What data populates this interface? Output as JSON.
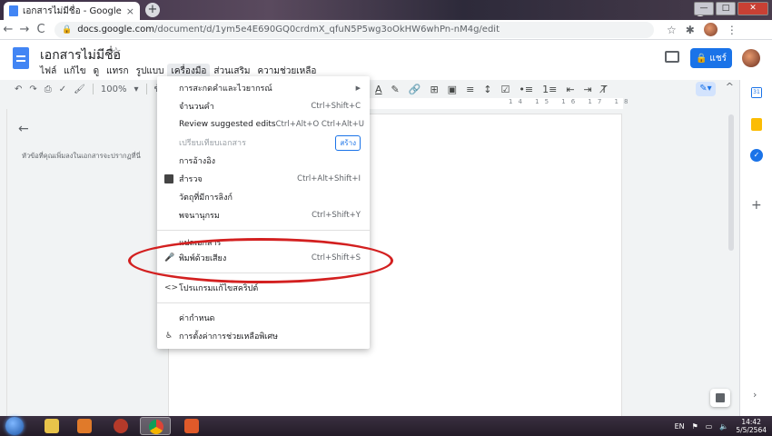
{
  "browser": {
    "tab_title": "เอกสารไม่มีชื่อ - Google เอกสาร",
    "tab_close": "×",
    "new_tab": "+",
    "url_host": "docs.google.com",
    "url_path": "/document/d/1ym5e4E690GQ0crdmX_qfuN5P5wg3oOkHW6whPn-nM4g/edit",
    "back": "←",
    "forward": "→",
    "reload": "C",
    "window_minimize": "—",
    "window_maximize": "□",
    "window_close": "✕"
  },
  "docs": {
    "title": "เอกสารไม่มีชื่อ",
    "star": "☆",
    "menu": [
      "ไฟล์",
      "แก้ไข",
      "ดู",
      "แทรก",
      "รูปแบบ",
      "เครื่องมือ",
      "ส่วนเสริม",
      "ความช่วยเหลือ"
    ],
    "share_label": "แชร์",
    "zoom": "100%",
    "style_partial": "ข้อ",
    "outline_hint": "หัวข้อที่คุณเพิ่มลงในเอกสารจะปรากฏที่นี่",
    "ruler_numbers": "14 15 16 17 18"
  },
  "tools_menu": {
    "items": [
      {
        "label": "การสะกดคำและไวยากรณ์",
        "shortcut": "",
        "has_submenu": true
      },
      {
        "label": "จำนวนคำ",
        "shortcut": "Ctrl+Shift+C"
      },
      {
        "label": "Review suggested edits",
        "shortcut": "Ctrl+Alt+O Ctrl+Alt+U"
      },
      {
        "label": "เปรียบเทียบเอกสาร",
        "shortcut": "",
        "disabled": true,
        "badge": "สร้าง"
      },
      {
        "label": "การอ้างอิง",
        "shortcut": ""
      },
      {
        "label": "สำรวจ",
        "shortcut": "Ctrl+Alt+Shift+I"
      },
      {
        "label": "วัตถุที่มีการลิงก์",
        "shortcut": ""
      },
      {
        "label": "พจนานุกรม",
        "shortcut": "Ctrl+Shift+Y"
      },
      {
        "label": "แปลเอกสาร",
        "shortcut": ""
      },
      {
        "label": "พิมพ์ด้วยเสียง",
        "shortcut": "Ctrl+Shift+S"
      },
      {
        "label": "โปรแกรมแก้ไขสคริปต์",
        "shortcut": ""
      },
      {
        "label": "ค่ากำหนด",
        "shortcut": ""
      },
      {
        "label": "การตั้งค่าการช่วยเหลือพิเศษ",
        "shortcut": ""
      }
    ]
  },
  "taskbar": {
    "lang": "EN",
    "time": "14:42",
    "date": "5/5/2564"
  },
  "colors": {
    "accent": "#1a73e8",
    "annotation": "#d32020"
  }
}
